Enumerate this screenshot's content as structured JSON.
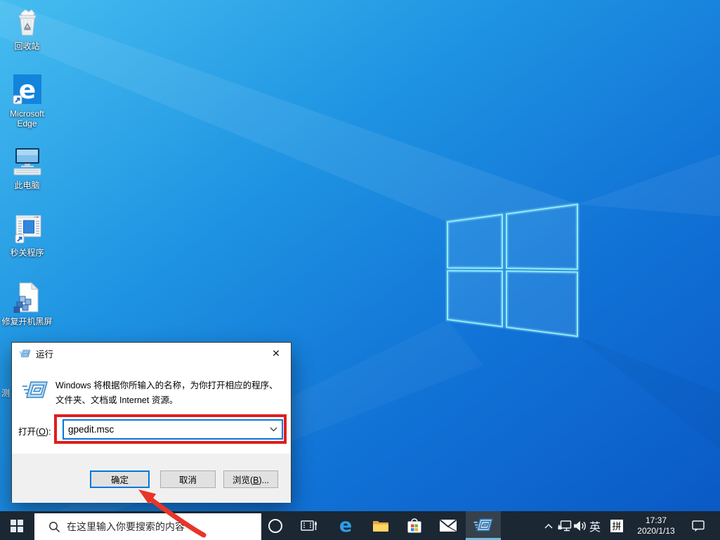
{
  "desktop": {
    "icons": [
      {
        "label": "回收站"
      },
      {
        "label": "Microsoft Edge"
      },
      {
        "label": "此电脑"
      },
      {
        "label": "秒关程序"
      },
      {
        "label": "修复开机黑屏"
      }
    ],
    "partial_icon_label": "测"
  },
  "run_dialog": {
    "title": "运行",
    "close_glyph": "✕",
    "description_line1": "Windows 将根据你所输入的名称，为你打开相应的程序、",
    "description_line2": "文件夹、文档或 Internet 资源。",
    "open_label": {
      "pre": "打开(",
      "key": "O",
      "post": "):"
    },
    "input_value": "gpedit.msc",
    "buttons": {
      "ok": "确定",
      "cancel": "取消",
      "browse": {
        "pre": "浏览(",
        "key": "B",
        "post": ")..."
      }
    }
  },
  "taskbar": {
    "search_placeholder": "在这里输入你要搜索的内容",
    "tray": {
      "ime_language": "英",
      "ime_mode": "拼",
      "time": "17:37",
      "date": "2020/1/13"
    }
  },
  "annotations": {
    "highlight_box_color": "#e11d1d",
    "arrow_color": "#e8352a"
  },
  "colors": {
    "taskbar_bg": "#1b2733",
    "accent_blue": "#0078d7",
    "active_app_underline": "#76b9e0",
    "wallpaper_top_left": "#46bdf0",
    "wallpaper_bottom_right": "#0a57c4",
    "logo_glow": "#8deffc"
  }
}
